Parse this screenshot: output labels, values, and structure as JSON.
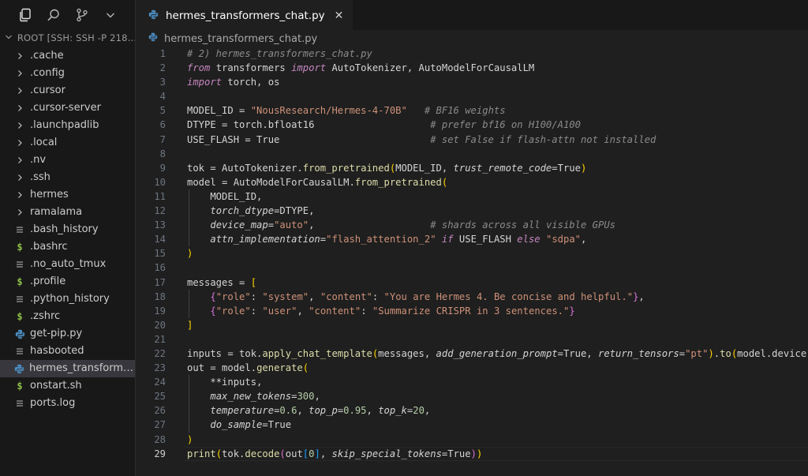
{
  "explorer": {
    "root_label": "ROOT [SSH: SSH -P 218...",
    "items": [
      {
        "label": ".cache",
        "kind": "folder"
      },
      {
        "label": ".config",
        "kind": "folder"
      },
      {
        "label": ".cursor",
        "kind": "folder"
      },
      {
        "label": ".cursor-server",
        "kind": "folder"
      },
      {
        "label": ".launchpadlib",
        "kind": "folder"
      },
      {
        "label": ".local",
        "kind": "folder"
      },
      {
        "label": ".nv",
        "kind": "folder"
      },
      {
        "label": ".ssh",
        "kind": "folder"
      },
      {
        "label": "hermes",
        "kind": "folder"
      },
      {
        "label": "ramalama",
        "kind": "folder"
      },
      {
        "label": ".bash_history",
        "kind": "text"
      },
      {
        "label": ".bashrc",
        "kind": "shell"
      },
      {
        "label": ".no_auto_tmux",
        "kind": "text"
      },
      {
        "label": ".profile",
        "kind": "shell"
      },
      {
        "label": ".python_history",
        "kind": "text"
      },
      {
        "label": ".zshrc",
        "kind": "shell"
      },
      {
        "label": "get-pip.py",
        "kind": "python"
      },
      {
        "label": "hasbooted",
        "kind": "text"
      },
      {
        "label": "hermes_transformers_chat.py",
        "kind": "python",
        "active": true
      },
      {
        "label": "onstart.sh",
        "kind": "shell"
      },
      {
        "label": "ports.log",
        "kind": "text"
      }
    ]
  },
  "tab": {
    "label": "hermes_transformers_chat.py",
    "close": "✕"
  },
  "breadcrumb": {
    "file": "hermes_transformers_chat.py"
  },
  "editor": {
    "current_line": 29,
    "lines": [
      "# 2) hermes_transformers_chat.py",
      "from transformers import AutoTokenizer, AutoModelForCausalLM",
      "import torch, os",
      "",
      "MODEL_ID = \"NousResearch/Hermes-4-70B\"   # BF16 weights",
      "DTYPE = torch.bfloat16                    # prefer bf16 on H100/A100",
      "USE_FLASH = True                          # set False if flash-attn not installed",
      "",
      "tok = AutoTokenizer.from_pretrained(MODEL_ID, trust_remote_code=True)",
      "model = AutoModelForCausalLM.from_pretrained(",
      "    MODEL_ID,",
      "    torch_dtype=DTYPE,",
      "    device_map=\"auto\",                    # shards across all visible GPUs",
      "    attn_implementation=\"flash_attention_2\" if USE_FLASH else \"sdpa\",",
      ")",
      "",
      "messages = [",
      "    {\"role\": \"system\", \"content\": \"You are Hermes 4. Be concise and helpful.\"},",
      "    {\"role\": \"user\", \"content\": \"Summarize CRISPR in 3 sentences.\"}",
      "]",
      "",
      "inputs = tok.apply_chat_template(messages, add_generation_prompt=True, return_tensors=\"pt\").to(model.device)",
      "out = model.generate(",
      "    **inputs,",
      "    max_new_tokens=300,",
      "    temperature=0.6, top_p=0.95, top_k=20,",
      "    do_sample=True",
      ")",
      "print(tok.decode(out[0], skip_special_tokens=True))"
    ]
  },
  "colors": {
    "keyword": "#c586c0",
    "string": "#ce9178",
    "comment": "#8b8b8b",
    "number": "#b5cea8",
    "function": "#dcdcaa",
    "python_icon": "#4b8bbe",
    "shell_icon": "#8dc149"
  },
  "icons": [
    "explorer-icon",
    "search-icon",
    "source-control-icon",
    "chevron-down-icon",
    "chevron-right-icon",
    "python-file-icon",
    "shell-file-icon",
    "text-file-icon",
    "close-icon"
  ]
}
